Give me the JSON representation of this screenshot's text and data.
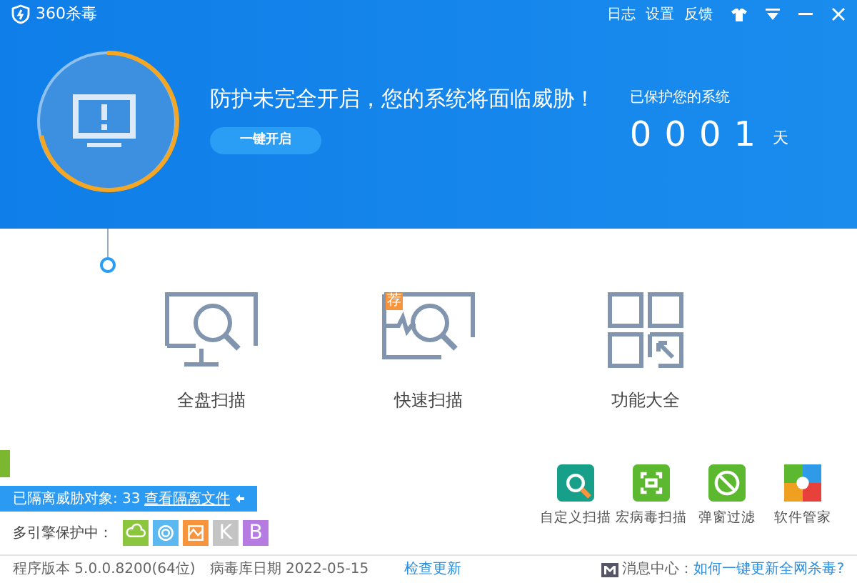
{
  "window": {
    "title": "360杀毒",
    "links": [
      "日志",
      "设置",
      "反馈"
    ]
  },
  "status": {
    "message": "防护未完全开启，您的系统将面临威胁！",
    "button": "一键开启",
    "protected_label": "已保护您的系统",
    "days": "0001",
    "unit": "天"
  },
  "scans": [
    {
      "kind": "full",
      "label": "全盘扫描"
    },
    {
      "kind": "quick",
      "label": "快速扫描",
      "badge": "荐"
    },
    {
      "kind": "all",
      "label": "功能大全"
    }
  ],
  "quarantine": {
    "text": "已隔离威胁对象: 33",
    "link": "查看隔离文件"
  },
  "engines": {
    "label": "多引擎保护中：",
    "items": [
      {
        "kind": "cloud",
        "color": "#8cc63f"
      },
      {
        "kind": "swirl",
        "color": "#5bb8f0"
      },
      {
        "kind": "chart",
        "color": "#f7943c"
      },
      {
        "kind": "letter",
        "color": "#c4c4c4",
        "letter": "K"
      },
      {
        "kind": "letter",
        "color": "#b57be0",
        "letter": "B"
      }
    ]
  },
  "tools": [
    {
      "kind": "custom",
      "label": "自定义扫描",
      "color": "#16a08a"
    },
    {
      "kind": "macro",
      "label": "宏病毒扫描",
      "color": "#5cb82e"
    },
    {
      "kind": "popup",
      "label": "弹窗过滤",
      "color": "#5cb82e"
    },
    {
      "kind": "software",
      "label": "软件管家",
      "color": "#f0a020"
    }
  ],
  "footer": {
    "version": "程序版本 5.0.0.8200(64位)",
    "database": "病毒库日期 2022-05-15",
    "update_link": "检查更新",
    "message_center": "消息中心：",
    "help_link": "如何一键更新全网杀毒?"
  }
}
